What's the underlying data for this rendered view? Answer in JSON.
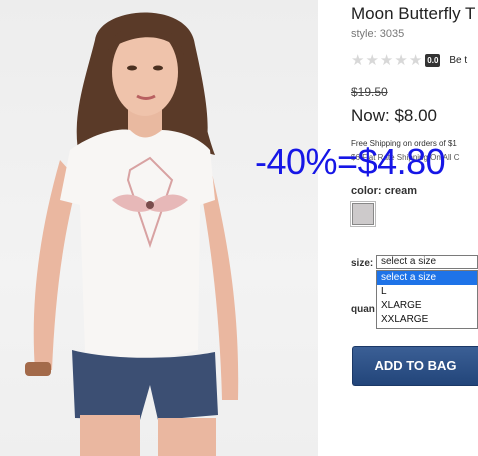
{
  "product": {
    "title": "Moon Butterfly T",
    "style": "style: 3035",
    "rating_score": "0.0",
    "review_link": "Be t",
    "old_price": "$19.50",
    "now_price": "Now: $8.00",
    "shipping_line_1": "Free Shipping on orders of $1",
    "shipping_line_2": "$6 Flat Rate Shipping On All C",
    "color_label": "color: cream",
    "swatch_color": "#cdcacb",
    "size_label": "size:",
    "size_selected": "select a size",
    "size_options": [
      "select a size",
      "L",
      "XLARGE",
      "XXLARGE"
    ],
    "quantity_label": "quan",
    "add_to_bag_label": "ADD TO BAG"
  },
  "overlay": {
    "discount_text": "-40%=$4.80",
    "discount_color": "#1616e6"
  },
  "icons": {
    "rating": "star-icon"
  }
}
